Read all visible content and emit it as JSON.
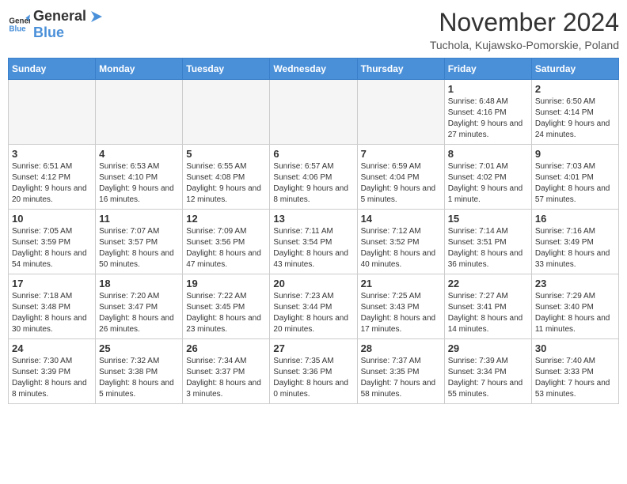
{
  "logo": {
    "general": "General",
    "blue": "Blue"
  },
  "header": {
    "month": "November 2024",
    "location": "Tuchola, Kujawsko-Pomorskie, Poland"
  },
  "weekdays": [
    "Sunday",
    "Monday",
    "Tuesday",
    "Wednesday",
    "Thursday",
    "Friday",
    "Saturday"
  ],
  "weeks": [
    [
      {
        "day": "",
        "info": ""
      },
      {
        "day": "",
        "info": ""
      },
      {
        "day": "",
        "info": ""
      },
      {
        "day": "",
        "info": ""
      },
      {
        "day": "",
        "info": ""
      },
      {
        "day": "1",
        "info": "Sunrise: 6:48 AM\nSunset: 4:16 PM\nDaylight: 9 hours and 27 minutes."
      },
      {
        "day": "2",
        "info": "Sunrise: 6:50 AM\nSunset: 4:14 PM\nDaylight: 9 hours and 24 minutes."
      }
    ],
    [
      {
        "day": "3",
        "info": "Sunrise: 6:51 AM\nSunset: 4:12 PM\nDaylight: 9 hours and 20 minutes."
      },
      {
        "day": "4",
        "info": "Sunrise: 6:53 AM\nSunset: 4:10 PM\nDaylight: 9 hours and 16 minutes."
      },
      {
        "day": "5",
        "info": "Sunrise: 6:55 AM\nSunset: 4:08 PM\nDaylight: 9 hours and 12 minutes."
      },
      {
        "day": "6",
        "info": "Sunrise: 6:57 AM\nSunset: 4:06 PM\nDaylight: 9 hours and 8 minutes."
      },
      {
        "day": "7",
        "info": "Sunrise: 6:59 AM\nSunset: 4:04 PM\nDaylight: 9 hours and 5 minutes."
      },
      {
        "day": "8",
        "info": "Sunrise: 7:01 AM\nSunset: 4:02 PM\nDaylight: 9 hours and 1 minute."
      },
      {
        "day": "9",
        "info": "Sunrise: 7:03 AM\nSunset: 4:01 PM\nDaylight: 8 hours and 57 minutes."
      }
    ],
    [
      {
        "day": "10",
        "info": "Sunrise: 7:05 AM\nSunset: 3:59 PM\nDaylight: 8 hours and 54 minutes."
      },
      {
        "day": "11",
        "info": "Sunrise: 7:07 AM\nSunset: 3:57 PM\nDaylight: 8 hours and 50 minutes."
      },
      {
        "day": "12",
        "info": "Sunrise: 7:09 AM\nSunset: 3:56 PM\nDaylight: 8 hours and 47 minutes."
      },
      {
        "day": "13",
        "info": "Sunrise: 7:11 AM\nSunset: 3:54 PM\nDaylight: 8 hours and 43 minutes."
      },
      {
        "day": "14",
        "info": "Sunrise: 7:12 AM\nSunset: 3:52 PM\nDaylight: 8 hours and 40 minutes."
      },
      {
        "day": "15",
        "info": "Sunrise: 7:14 AM\nSunset: 3:51 PM\nDaylight: 8 hours and 36 minutes."
      },
      {
        "day": "16",
        "info": "Sunrise: 7:16 AM\nSunset: 3:49 PM\nDaylight: 8 hours and 33 minutes."
      }
    ],
    [
      {
        "day": "17",
        "info": "Sunrise: 7:18 AM\nSunset: 3:48 PM\nDaylight: 8 hours and 30 minutes."
      },
      {
        "day": "18",
        "info": "Sunrise: 7:20 AM\nSunset: 3:47 PM\nDaylight: 8 hours and 26 minutes."
      },
      {
        "day": "19",
        "info": "Sunrise: 7:22 AM\nSunset: 3:45 PM\nDaylight: 8 hours and 23 minutes."
      },
      {
        "day": "20",
        "info": "Sunrise: 7:23 AM\nSunset: 3:44 PM\nDaylight: 8 hours and 20 minutes."
      },
      {
        "day": "21",
        "info": "Sunrise: 7:25 AM\nSunset: 3:43 PM\nDaylight: 8 hours and 17 minutes."
      },
      {
        "day": "22",
        "info": "Sunrise: 7:27 AM\nSunset: 3:41 PM\nDaylight: 8 hours and 14 minutes."
      },
      {
        "day": "23",
        "info": "Sunrise: 7:29 AM\nSunset: 3:40 PM\nDaylight: 8 hours and 11 minutes."
      }
    ],
    [
      {
        "day": "24",
        "info": "Sunrise: 7:30 AM\nSunset: 3:39 PM\nDaylight: 8 hours and 8 minutes."
      },
      {
        "day": "25",
        "info": "Sunrise: 7:32 AM\nSunset: 3:38 PM\nDaylight: 8 hours and 5 minutes."
      },
      {
        "day": "26",
        "info": "Sunrise: 7:34 AM\nSunset: 3:37 PM\nDaylight: 8 hours and 3 minutes."
      },
      {
        "day": "27",
        "info": "Sunrise: 7:35 AM\nSunset: 3:36 PM\nDaylight: 8 hours and 0 minutes."
      },
      {
        "day": "28",
        "info": "Sunrise: 7:37 AM\nSunset: 3:35 PM\nDaylight: 7 hours and 58 minutes."
      },
      {
        "day": "29",
        "info": "Sunrise: 7:39 AM\nSunset: 3:34 PM\nDaylight: 7 hours and 55 minutes."
      },
      {
        "day": "30",
        "info": "Sunrise: 7:40 AM\nSunset: 3:33 PM\nDaylight: 7 hours and 53 minutes."
      }
    ]
  ]
}
